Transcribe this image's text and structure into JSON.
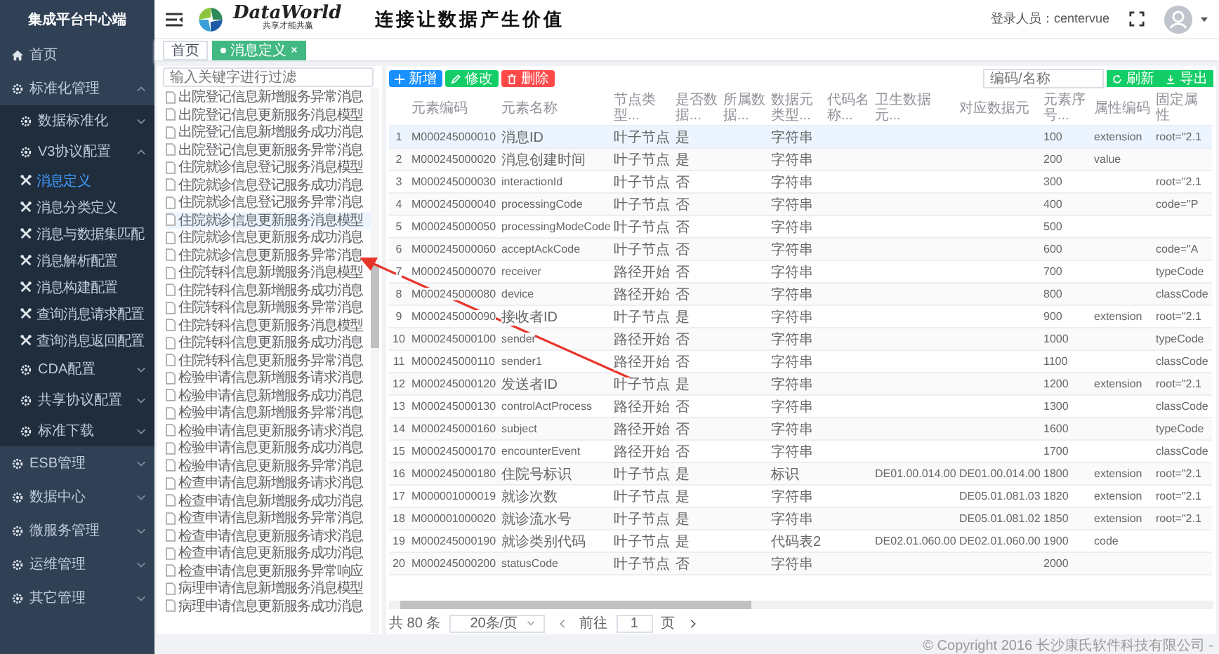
{
  "sidebar": {
    "title": "集成平台中心端",
    "items": [
      {
        "label": "首页",
        "kind": "leaf",
        "selected": false
      },
      {
        "label": "标准化管理",
        "kind": "group",
        "expanded": true,
        "children": [
          {
            "label": "数据标准化",
            "kind": "group",
            "expanded": false
          },
          {
            "label": "V3协议配置",
            "kind": "group",
            "expanded": true,
            "children": [
              {
                "label": "消息定义",
                "kind": "leaf",
                "selected": true
              },
              {
                "label": "消息分类定义",
                "kind": "leaf",
                "selected": false
              },
              {
                "label": "消息与数据集匹配",
                "kind": "leaf",
                "selected": false
              },
              {
                "label": "消息解析配置",
                "kind": "leaf",
                "selected": false
              },
              {
                "label": "消息构建配置",
                "kind": "leaf",
                "selected": false
              },
              {
                "label": "查询消息请求配置",
                "kind": "leaf",
                "selected": false
              },
              {
                "label": "查询消息返回配置",
                "kind": "leaf",
                "selected": false
              }
            ]
          },
          {
            "label": "CDA配置",
            "kind": "group",
            "expanded": false
          },
          {
            "label": "共享协议配置",
            "kind": "group",
            "expanded": false
          },
          {
            "label": "标准下载",
            "kind": "group",
            "expanded": false
          }
        ]
      },
      {
        "label": "ESB管理",
        "kind": "group",
        "expanded": false
      },
      {
        "label": "数据中心",
        "kind": "group",
        "expanded": false
      },
      {
        "label": "微服务管理",
        "kind": "group",
        "expanded": false
      },
      {
        "label": "运维管理",
        "kind": "group",
        "expanded": false
      },
      {
        "label": "其它管理",
        "kind": "group",
        "expanded": false
      }
    ]
  },
  "header": {
    "logo_text": "DataWorld",
    "logo_subtitle": "共享才能共赢",
    "slogan": "连接让数据产生价值",
    "user_label": "登录人员：centervue"
  },
  "tabs": [
    {
      "label": "首页",
      "selected": false
    },
    {
      "label": "消息定义",
      "selected": true
    }
  ],
  "tree": {
    "placeholder": "输入关键字进行过滤",
    "items": [
      {
        "label": "出院登记信息新增服务异常消息",
        "selected": false
      },
      {
        "label": "出院登记信息更新服务消息模型",
        "selected": false
      },
      {
        "label": "出院登记信息新增服务成功消息",
        "selected": false
      },
      {
        "label": "出院登记信息更新服务异常消息",
        "selected": false
      },
      {
        "label": "住院就诊信息登记服务消息模型",
        "selected": false
      },
      {
        "label": "住院就诊信息登记服务成功消息",
        "selected": false
      },
      {
        "label": "住院就诊信息登记服务异常消息",
        "selected": false
      },
      {
        "label": "住院就诊信息更新服务消息模型",
        "selected": true
      },
      {
        "label": "住院就诊信息更新服务成功消息",
        "selected": false
      },
      {
        "label": "住院就诊信息更新服务异常消息",
        "selected": false
      },
      {
        "label": "住院转科信息新增服务消息模型",
        "selected": false
      },
      {
        "label": "住院转科信息新增服务成功消息",
        "selected": false
      },
      {
        "label": "住院转科信息新增服务异常消息",
        "selected": false
      },
      {
        "label": "住院转科信息更新服务消息模型",
        "selected": false
      },
      {
        "label": "住院转科信息更新服务成功消息",
        "selected": false
      },
      {
        "label": "住院转科信息更新服务异常消息",
        "selected": false
      },
      {
        "label": "检验申请信息新增服务请求消息",
        "selected": false
      },
      {
        "label": "检验申请信息新增服务成功消息",
        "selected": false
      },
      {
        "label": "检验申请信息新增服务异常消息",
        "selected": false
      },
      {
        "label": "检验申请信息更新服务请求消息",
        "selected": false
      },
      {
        "label": "检验申请信息更新服务成功消息",
        "selected": false
      },
      {
        "label": "检验申请信息更新服务异常消息",
        "selected": false
      },
      {
        "label": "检查申请信息新增服务请求消息",
        "selected": false
      },
      {
        "label": "检查申请信息新增服务成功消息",
        "selected": false
      },
      {
        "label": "检查申请信息新增服务异常消息",
        "selected": false
      },
      {
        "label": "检查申请信息更新服务请求消息",
        "selected": false
      },
      {
        "label": "检查申请信息更新服务成功消息",
        "selected": false
      },
      {
        "label": "检查申请信息更新服务异常响应",
        "selected": false
      },
      {
        "label": "病理申请信息新增服务消息模型",
        "selected": false
      },
      {
        "label": "病理申请信息更新服务成功消息",
        "selected": false
      }
    ]
  },
  "toolbar": {
    "buttons": [
      {
        "label": "新增",
        "kind": "add"
      },
      {
        "label": "修改",
        "kind": "edit"
      },
      {
        "label": "删除",
        "kind": "delete"
      }
    ],
    "search_placeholder": "编码/名称",
    "actions": [
      {
        "label": "刷新",
        "kind": "refresh"
      },
      {
        "label": "导出",
        "kind": "export"
      }
    ]
  },
  "table": {
    "columns": [
      "",
      "元素编码",
      "元素名称",
      "节点类型...",
      "是否数据...",
      "所属数据...",
      "数据元类型...",
      "代码名称...",
      "卫生数据元...",
      "对应数据元",
      "元素序号...",
      "属性编码",
      "固定属性"
    ],
    "rows": [
      {
        "selected": true,
        "cells": [
          "1",
          "M000245000010",
          "消息ID",
          "叶子节点",
          "是",
          null,
          "字符串",
          null,
          null,
          null,
          "100",
          "extension",
          "root=\"2.1"
        ]
      },
      {
        "selected": false,
        "cells": [
          "2",
          "M000245000020",
          "消息创建时间",
          "叶子节点",
          "是",
          null,
          "字符串",
          null,
          null,
          null,
          "200",
          "value",
          null
        ]
      },
      {
        "selected": false,
        "cells": [
          "3",
          "M000245000030",
          "interactionId",
          "叶子节点",
          "否",
          null,
          "字符串",
          null,
          null,
          null,
          "300",
          null,
          "root=\"2.1"
        ]
      },
      {
        "selected": false,
        "cells": [
          "4",
          "M000245000040",
          "processingCode",
          "叶子节点",
          "否",
          null,
          "字符串",
          null,
          null,
          null,
          "400",
          null,
          "code=\"P"
        ]
      },
      {
        "selected": false,
        "cells": [
          "5",
          "M000245000050",
          "processingModeCode",
          "叶子节点",
          "否",
          null,
          "字符串",
          null,
          null,
          null,
          "500",
          null,
          null
        ]
      },
      {
        "selected": false,
        "cells": [
          "6",
          "M000245000060",
          "acceptAckCode",
          "叶子节点",
          "否",
          null,
          "字符串",
          null,
          null,
          null,
          "600",
          null,
          "code=\"A"
        ]
      },
      {
        "selected": false,
        "cells": [
          "7",
          "M000245000070",
          "receiver",
          "路径开始",
          "否",
          null,
          "字符串",
          null,
          null,
          null,
          "700",
          null,
          "typeCode"
        ]
      },
      {
        "selected": false,
        "cells": [
          "8",
          "M000245000080",
          "device",
          "路径开始",
          "否",
          null,
          "字符串",
          null,
          null,
          null,
          "800",
          null,
          "classCode"
        ]
      },
      {
        "selected": false,
        "cells": [
          "9",
          "M000245000090",
          "接收者ID",
          "叶子节点",
          "是",
          null,
          "字符串",
          null,
          null,
          null,
          "900",
          "extension",
          "root=\"2.1"
        ]
      },
      {
        "selected": false,
        "cells": [
          "10",
          "M000245000100",
          "sender",
          "路径开始",
          "否",
          null,
          "字符串",
          null,
          null,
          null,
          "1000",
          null,
          "typeCode"
        ]
      },
      {
        "selected": false,
        "cells": [
          "11",
          "M000245000110",
          "sender1",
          "路径开始",
          "否",
          null,
          "字符串",
          null,
          null,
          null,
          "1100",
          null,
          "classCode"
        ]
      },
      {
        "selected": false,
        "cells": [
          "12",
          "M000245000120",
          "发送者ID",
          "叶子节点",
          "是",
          null,
          "字符串",
          null,
          null,
          null,
          "1200",
          "extension",
          "root=\"2.1"
        ]
      },
      {
        "selected": false,
        "cells": [
          "13",
          "M000245000130",
          "controlActProcess",
          "路径开始",
          "否",
          null,
          "字符串",
          null,
          null,
          null,
          "1300",
          null,
          "classCode"
        ]
      },
      {
        "selected": false,
        "cells": [
          "14",
          "M000245000160",
          "subject",
          "路径开始",
          "否",
          null,
          "字符串",
          null,
          null,
          null,
          "1600",
          null,
          "typeCode"
        ]
      },
      {
        "selected": false,
        "cells": [
          "15",
          "M000245000170",
          "encounterEvent",
          "路径开始",
          "否",
          null,
          "字符串",
          null,
          null,
          null,
          "1700",
          null,
          "classCode"
        ]
      },
      {
        "selected": false,
        "cells": [
          "16",
          "M000245000180",
          "住院号标识",
          "叶子节点",
          "是",
          null,
          "标识",
          null,
          "DE01.00.014.00",
          "DE01.00.014.00",
          "1800",
          "extension",
          "root=\"2.1"
        ]
      },
      {
        "selected": false,
        "cells": [
          "17",
          "M000001000019",
          "就诊次数",
          "叶子节点",
          "是",
          null,
          "字符串",
          null,
          null,
          "DE05.01.081.03",
          "1820",
          "extension",
          "root=\"2.1"
        ]
      },
      {
        "selected": false,
        "cells": [
          "18",
          "M000001000020",
          "就诊流水号",
          "叶子节点",
          "是",
          null,
          "字符串",
          null,
          null,
          "DE05.01.081.02",
          "1850",
          "extension",
          "root=\"2.1"
        ]
      },
      {
        "selected": false,
        "cells": [
          "19",
          "M000245000190",
          "就诊类别代码",
          "叶子节点",
          "是",
          null,
          "代码表2",
          null,
          "DE02.01.060.00",
          "DE02.01.060.00",
          "1900",
          "code",
          null
        ]
      },
      {
        "selected": false,
        "cells": [
          "20",
          "M000245000200",
          "statusCode",
          "叶子节点",
          "否",
          null,
          "字符串",
          null,
          null,
          null,
          "2000",
          null,
          null
        ]
      }
    ]
  },
  "pagination": {
    "total": "共 80 条",
    "page_size": "20条/页",
    "goto_label": "前往",
    "page": "1",
    "page_unit": "页"
  },
  "footer": {
    "copyright": "© Copyright 2016 长沙康氏软件科技有限公司 -"
  }
}
